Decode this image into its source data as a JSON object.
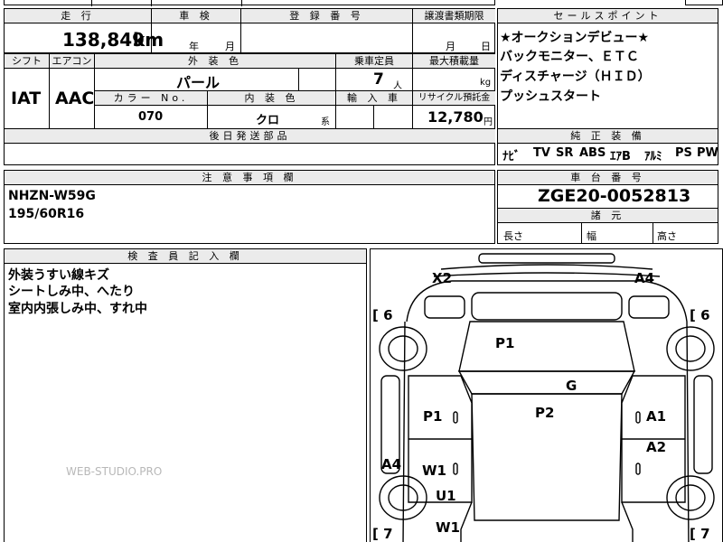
{
  "header": {
    "mileage_label": "走 行",
    "mileage_value": "138,849",
    "mileage_unit": "km",
    "shaken_label": "車 検",
    "shaken_year": "年",
    "shaken_month": "月",
    "registration_label": "登 録 番 号",
    "transfer_label": "譲渡書類期限",
    "transfer_month": "月",
    "transfer_day": "日"
  },
  "spec": {
    "shift_label": "シフト",
    "shift_value": "IAT",
    "aircon_label": "エアコン",
    "aircon_value": "AAC",
    "exterior_label": "外 装 色",
    "exterior_value": "パール",
    "capacity_label": "乗車定員",
    "capacity_value": "7",
    "capacity_unit": "人",
    "maxload_label": "最大積載量",
    "maxload_unit": "kg",
    "colorno_label": "カラー No.",
    "colorno_value": "070",
    "interior_label": "内 装 色",
    "interior_value": "クロ",
    "interior_suffix": "系",
    "import_label": "輸 入 車",
    "recycle_label": "リサイクル預託金",
    "recycle_value": "12,780",
    "recycle_unit": "円",
    "parts_label": "後日発送部品"
  },
  "salespoint": {
    "label": "セールスポイント",
    "lines": [
      "★オークションデビュー★",
      "バックモニター、ＥＴＣ",
      "ディスチャージ（ＨＩＤ）",
      "プッシュスタート"
    ]
  },
  "equipment": {
    "label": "純 正 装 備",
    "items": [
      "ﾅﾋﾞ",
      "TV",
      "SR",
      "ABS",
      "ｴｱB",
      "ｱﾙﾐ",
      "PS",
      "PW"
    ]
  },
  "notes": {
    "label": "注 意 事 項 欄",
    "lines": [
      "NHZN-W59G",
      "195/60R16"
    ]
  },
  "chassis": {
    "label": "車 台 番 号",
    "value": "ZGE20-0052813",
    "specs_label": "諸 元",
    "length_label": "長さ",
    "width_label": "幅",
    "height_label": "高さ"
  },
  "inspector": {
    "label": "検 査 員 記 入 欄",
    "lines": [
      "外装うすい線キズ",
      "シートしみ中、へたり",
      "室内内張しみ中、すれ中"
    ],
    "watermark": "WEB-STUDIO.PRO"
  },
  "diagram": {
    "marks": {
      "x2": "X2",
      "a4_top": "A4",
      "p1_hood": "P1",
      "g": "G",
      "p2": "P2",
      "p1_left": "P1",
      "a1_right": "A1",
      "a2_right": "A2",
      "a4_left": "A4",
      "w1_left": "W1",
      "u1": "U1",
      "w1_bottom": "W1"
    },
    "tyre_depth_labels": [
      "[ 6",
      "[ 6",
      "[ 7",
      "[ 7"
    ]
  }
}
